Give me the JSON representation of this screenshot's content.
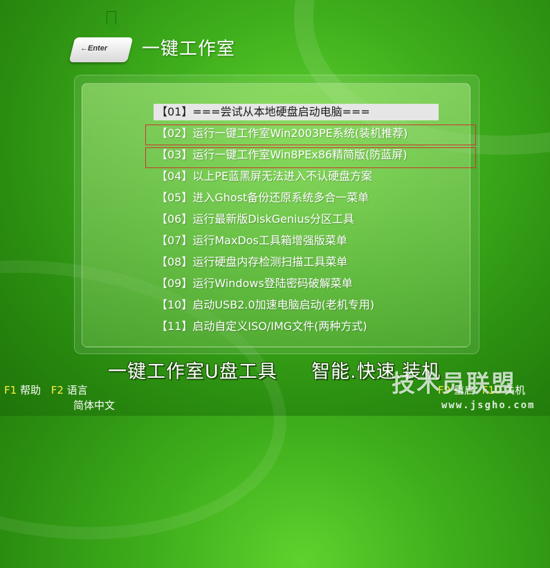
{
  "header": {
    "key_label": "←Enter",
    "title": "一键工作室"
  },
  "menu": {
    "items": [
      {
        "label": "【01】===尝试从本地硬盘启动电脑==="
      },
      {
        "label": "【02】运行一键工作室Win2003PE系统(装机推荐)"
      },
      {
        "label": "【03】运行一键工作室Win8PEx86精简版(防蓝屏)"
      },
      {
        "label": "【04】以上PE蓝黑屏无法进入不认硬盘方案"
      },
      {
        "label": "【05】进入Ghost备份还原系统多合一菜单"
      },
      {
        "label": "【06】运行最新版DiskGenius分区工具"
      },
      {
        "label": "【07】运行MaxDos工具箱增强版菜单"
      },
      {
        "label": "【08】运行硬盘内存检测扫描工具菜单"
      },
      {
        "label": "【09】运行Windows登陆密码破解菜单"
      },
      {
        "label": "【10】启动USB2.0加速电脑启动(老机专用)"
      },
      {
        "label": "【11】启动自定义ISO/IMG文件(两种方式)"
      }
    ],
    "selected_index": 0
  },
  "slogan": {
    "left": "一键工作室U盘工具",
    "right": "智能.快速.装机"
  },
  "footer": {
    "f1_key": "F1",
    "f1_text": "帮助",
    "f2_key": "F2",
    "f2_text": "语言",
    "language_current": "简体中文",
    "f9_key": "F9",
    "f9_text": "重启",
    "f10_key": "F10",
    "f10_text": "关机"
  },
  "watermark": {
    "text": "技术员联盟",
    "url": "www.jsgho.com"
  },
  "colors": {
    "background": "#3fae1c",
    "selection": "#e6e6e6",
    "highlight_box": "#d0342c",
    "fkey": "#ffee44"
  }
}
